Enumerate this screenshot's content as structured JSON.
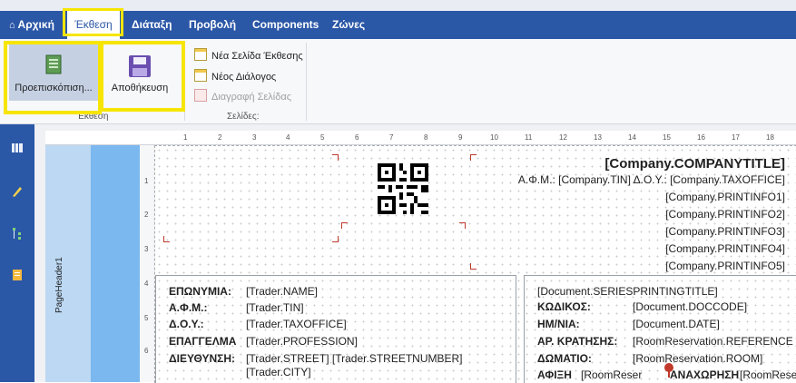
{
  "menu": {
    "home": "Αρχική",
    "report": "Έκθεση",
    "layout": "Διάταξη",
    "view": "Προβολή",
    "components": "Components",
    "zones": "Ζώνες"
  },
  "ribbon": {
    "preview_label": "Προεπισκόπιση...",
    "save_label": "Αποθήκευση",
    "group_report": "Έκθεση",
    "new_page": "Νέα Σελίδα Έκθεσης",
    "new_dialog": "Νέος Διάλογος",
    "delete_page": "Διαγραφή Σελίδας",
    "group_pages": "Σελίδες:"
  },
  "ruler": {
    "top": [
      "1",
      "2",
      "3",
      "4",
      "5",
      "6",
      "7",
      "8",
      "9",
      "10",
      "11",
      "12",
      "13",
      "14",
      "15",
      "16",
      "17",
      "18"
    ],
    "left": [
      "1",
      "2",
      "3",
      "4",
      "5",
      "6"
    ]
  },
  "band": {
    "name": "PageHeader1"
  },
  "header": {
    "company_title": "[Company.COMPANYTITLE]",
    "tax_line": "Α.Φ.Μ.: [Company.TIN] Δ.Ο.Υ.: [Company.TAXOFFICE]",
    "info": [
      "[Company.PRINTINFO1]",
      "[Company.PRINTINFO2]",
      "[Company.PRINTINFO3]",
      "[Company.PRINTINFO4]",
      "[Company.PRINTINFO5]"
    ]
  },
  "trader": {
    "rows": [
      {
        "label": "ΕΠΩΝΥΜΙΑ:",
        "value": "[Trader.NAME]"
      },
      {
        "label": "Α.Φ.Μ.:",
        "value": "[Trader.TIN]"
      },
      {
        "label": "Δ.Ο.Υ.:",
        "value": "[Trader.TAXOFFICE]"
      },
      {
        "label": "ΕΠΑΓΓΕΛΜΑ",
        "value": "[Trader.PROFESSION]"
      },
      {
        "label": "ΔΙΕΥΘΥΝΣΗ:",
        "value": "[Trader.STREET] [Trader.STREETNUMBER]"
      }
    ],
    "city": "[Trader.CITY]"
  },
  "document": {
    "series_title": "[Document.SERIESPRINTINGTITLE]",
    "rows": [
      {
        "label": "ΚΩΔΙΚΟΣ:",
        "value": "[Document.DOCCODE]"
      },
      {
        "label": "ΗΜ/ΝΙΑ:",
        "value": "[Document.DATE]"
      },
      {
        "label": "ΑΡ. ΚΡΑΤΗΣΗΣ:",
        "value": "[RoomReservation.REFERENCE"
      },
      {
        "label": "ΔΩΜΑΤΙΟ:",
        "value": "[RoomReservation.ROOM]"
      }
    ],
    "arrival_label": "ΑΦΙΞΗ",
    "arrival_value": "[RoomReser",
    "departure_label": "ΑΝΑΧΩΡΗΣΗ",
    "departure_value": "[RoomReser"
  }
}
